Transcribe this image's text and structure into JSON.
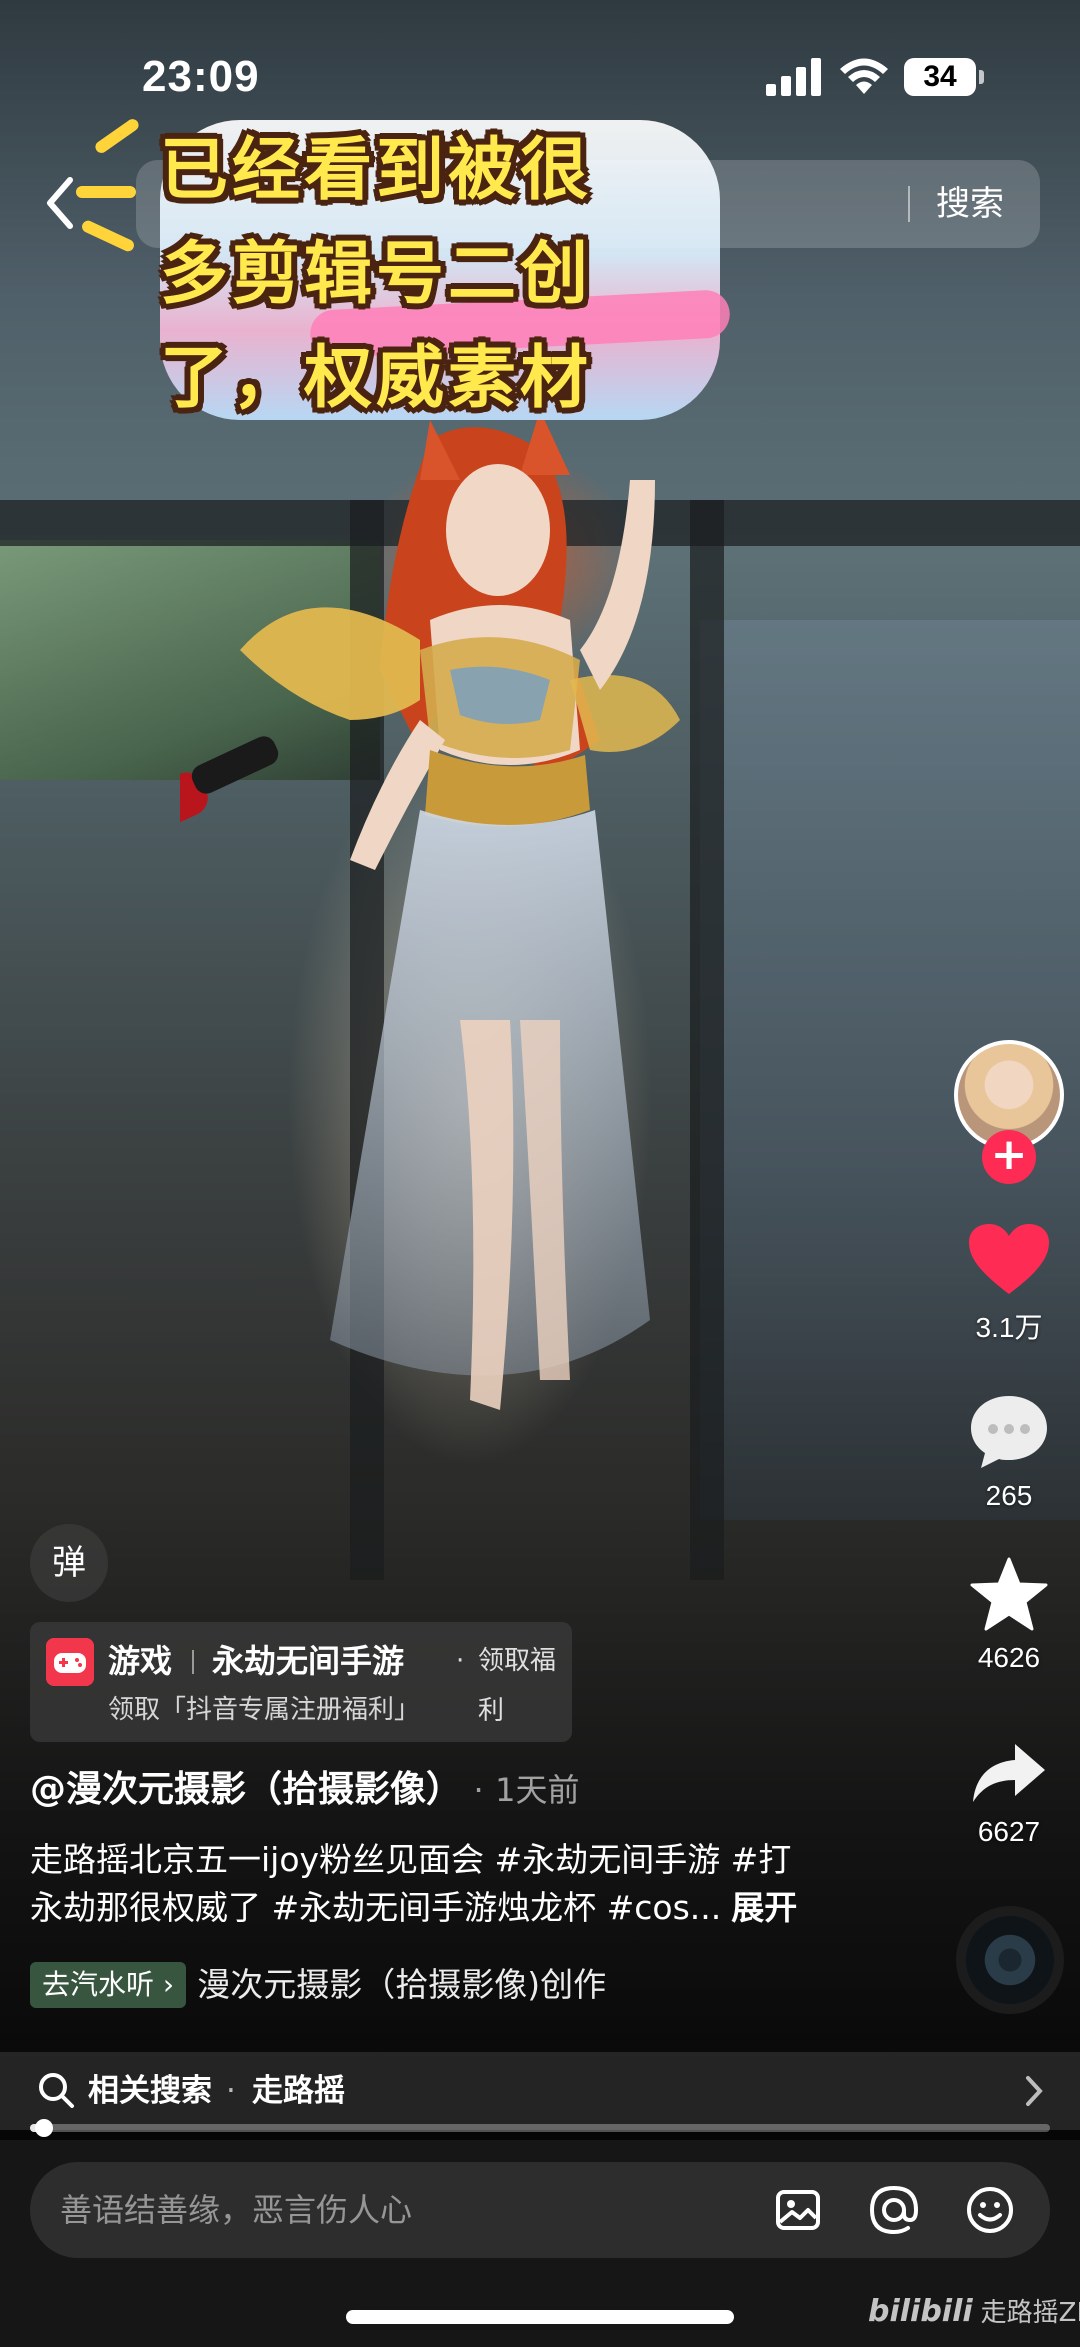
{
  "status_bar": {
    "time": "23:09",
    "battery": "34"
  },
  "top_nav": {
    "search_label": "搜索"
  },
  "sticker_caption": {
    "lines": [
      "已经看到被很",
      "多剪辑号二创",
      "了，权威素材"
    ]
  },
  "actions": {
    "likes": "3.1万",
    "comments": "265",
    "favorites": "4626",
    "shares": "6627"
  },
  "danmaku_label": "弹",
  "game_card": {
    "category": "游戏",
    "game_name": "永劫无间手游",
    "dot": "·",
    "benefit": "领取福利",
    "subtitle": "领取「抖音专属注册福利」"
  },
  "post": {
    "author": "@漫次元摄影（拾摄影像）",
    "time_separator": "·",
    "time": "1天前",
    "description_lines": [
      "走路摇北京五一ijoy粉丝见面会 #永劫无间手游 #打",
      "永劫那很权威了 #永劫无间手游烛龙杯 #cos..."
    ],
    "expand_label": "展开",
    "listen_tag": "去汽水听",
    "credit": "漫次元摄影（拾摄影像)创作"
  },
  "related_search": {
    "label": "相关搜索",
    "dot": "·",
    "term": "走路摇"
  },
  "progress": {
    "value": 0.014
  },
  "composer": {
    "placeholder": "善语结善缘，恶言伤人心"
  },
  "watermark": {
    "logo": "bilibili",
    "text": "走路摇ZLY"
  },
  "colors": {
    "like_red": "#fe2c55",
    "follow_red": "#fe2c55",
    "sticker_yellow": "#ffe94d"
  },
  "icons": {
    "back": "chevron-left-icon",
    "like": "heart-icon",
    "comment": "speech-bubble-icon",
    "favorite": "star-icon",
    "share": "share-arrow-icon",
    "search": "search-icon",
    "image": "image-icon",
    "mention": "at-sign-icon",
    "emoji": "emoji-icon"
  }
}
